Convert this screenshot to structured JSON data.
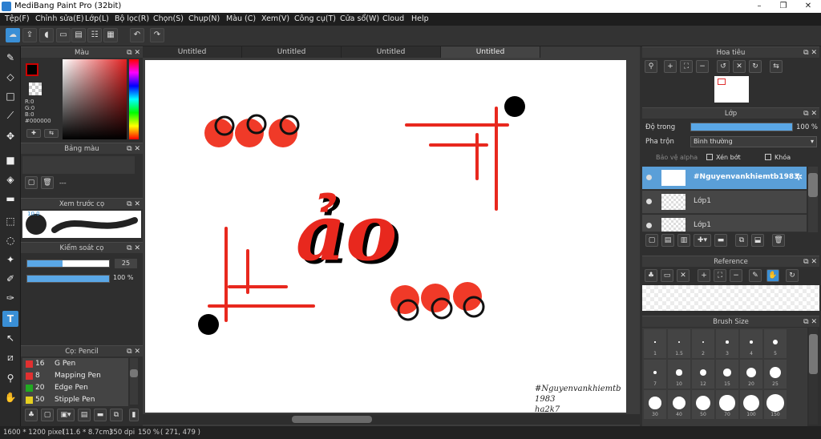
{
  "app": {
    "title": "MediBang Paint Pro (32bit)",
    "win_min": "–",
    "win_max": "□",
    "win_close": "✕",
    "win_restore": "❐"
  },
  "menu": [
    "Tệp(F)",
    "Chỉnh sửa(E)",
    "Lớp(L)",
    "Bộ lọc(R)",
    "Chọn(S)",
    "Chụp(N)",
    "Màu (C)",
    "Xem(V)",
    "Công cụ(T)",
    "Cửa sổ(W)",
    "Cloud",
    "Help"
  ],
  "toolbar": {
    "undo_glyph": "↶",
    "redo_glyph": "↷"
  },
  "panels": {
    "color": {
      "title": "Màu",
      "r": "R:0",
      "g": "G:0",
      "b": "B:0",
      "hex": "#000000",
      "fg": "#000000",
      "accent_red": "#cc0000"
    },
    "palette": {
      "title": "Bảng màu",
      "text": "---"
    },
    "preview": {
      "title": "Xem trước cọ",
      "size": "10.0"
    },
    "control": {
      "title": "Kiểm soát cọ",
      "size_value": "25",
      "opacity_value": "100 %",
      "size_fraction": 0.43,
      "opacity_fraction": 1.0
    },
    "brush": {
      "title": "Cọ: Pencil",
      "items": [
        {
          "size": "16",
          "name": "G Pen",
          "color": "#e03030"
        },
        {
          "size": "8",
          "name": "Mapping Pen",
          "color": "#e03030"
        },
        {
          "size": "20",
          "name": "Edge Pen",
          "color": "#22aa22"
        },
        {
          "size": "50",
          "name": "Stipple Pen",
          "color": "#e6d020"
        }
      ]
    }
  },
  "tabs": [
    "Untitled",
    "Untitled",
    "Untitled",
    "Untitled"
  ],
  "canvas": {
    "signature": "#Nguyenvankhiemtb 1983",
    "signature2": "ha2k7",
    "stroke_color": "#e8281e",
    "ink_color": "#000000"
  },
  "right": {
    "navigator": {
      "title": "Hoa tiêu"
    },
    "layer": {
      "title": "Lớp",
      "opacity_label": "Độ trong",
      "opacity_value": "100 %",
      "opacity_fraction": 1.0,
      "blend_label": "Pha trộn",
      "blend_value": "Bình thường",
      "protect_alpha": "Bảo vệ alpha",
      "clip": "Xén bớt",
      "lock": "Khóa",
      "layers": [
        {
          "name": "#Nguyenvankhiemtb1983",
          "selected": true
        },
        {
          "name": "Lớp1",
          "selected": false
        },
        {
          "name": "Lớp1",
          "selected": false
        }
      ]
    },
    "reference": {
      "title": "Reference"
    },
    "brushsize": {
      "title": "Brush Size",
      "sizes": [
        "1",
        "1.5",
        "2",
        "3",
        "4",
        "5",
        "7",
        "10",
        "12",
        "15",
        "20",
        "25",
        "30",
        "40",
        "50",
        "70",
        "100",
        "150"
      ]
    }
  },
  "status": {
    "dims": "1600 * 1200 pixel",
    "cm": "(11.6 * 8.7cm)",
    "dpi": "350 dpi",
    "zoom": "150 %",
    "coords": "( 271, 479 )"
  }
}
